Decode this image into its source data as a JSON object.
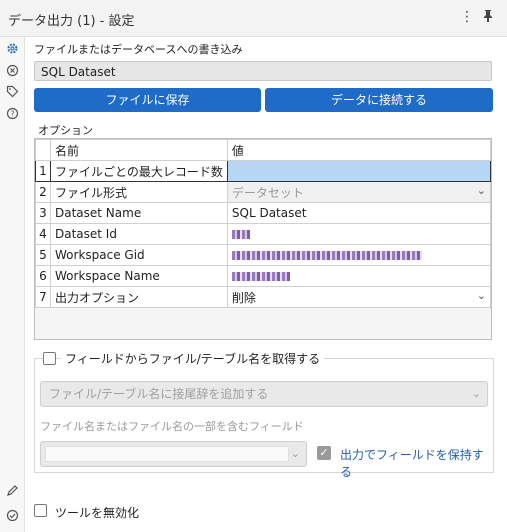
{
  "titlebar": {
    "title": "データ出力 (1) - 設定",
    "menu_icon": "⋮",
    "pin_icon": "📌"
  },
  "leftbar": {
    "icons": [
      "gear-icon",
      "x-circle-icon",
      "tag-icon",
      "help-icon",
      "pencil-icon",
      "check-circle-icon"
    ]
  },
  "write_section": {
    "label": "ファイルまたはデータベースへの書き込み",
    "dataset_value": "SQL Dataset",
    "save_to_file_label": "ファイルに保存",
    "connect_data_label": "データに接続する"
  },
  "options": {
    "label": "オプション",
    "col_name": "名前",
    "col_value": "値",
    "rows": [
      {
        "num": "1",
        "name": "ファイルごとの最大レコード数",
        "value": ""
      },
      {
        "num": "2",
        "name": "ファイル形式",
        "value": "データセット"
      },
      {
        "num": "3",
        "name": "Dataset Name",
        "value": "SQL Dataset"
      },
      {
        "num": "4",
        "name": "Dataset Id",
        "value": ""
      },
      {
        "num": "5",
        "name": "Workspace Gid",
        "value": ""
      },
      {
        "num": "6",
        "name": "Workspace Name",
        "value": ""
      },
      {
        "num": "7",
        "name": "出力オプション",
        "value": "削除"
      }
    ]
  },
  "field_group": {
    "title": "フィールドからファイル/テーブル名を取得する",
    "suffix_select": "ファイル/テーブル名に接尾辞を追加する",
    "field_label": "ファイル名またはファイル名の一部を含むフィールド",
    "keep_field_label": "出力でフィールドを保持する"
  },
  "disable_tool_label": "ツールを無効化",
  "colors": {
    "accent": "#1f6bc8",
    "selected_row": "#b7d5f5"
  }
}
